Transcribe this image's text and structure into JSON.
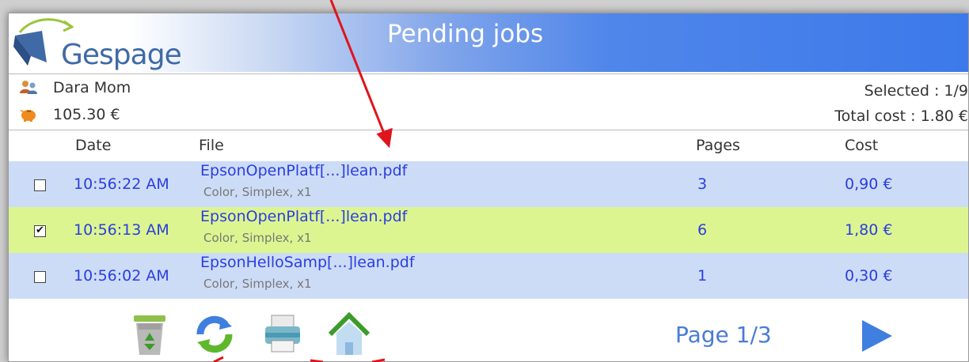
{
  "app": {
    "logo_text": "Gespage",
    "title": "Pending jobs"
  },
  "user": {
    "name": "Dara Mom",
    "balance": "105.30 €",
    "user_icon": "users-icon",
    "balance_icon": "piggy-bank-icon"
  },
  "summary": {
    "selected": "Selected : 1/9",
    "total_cost": "Total cost : 1.80 €"
  },
  "table": {
    "headers": {
      "date": "Date",
      "file": "File",
      "pages": "Pages",
      "cost": "Cost"
    },
    "rows": [
      {
        "checked": false,
        "time": "10:56:22 AM",
        "file": "EpsonOpenPlatf[...]lean.pdf",
        "options": "Color, Simplex, x1",
        "pages": "3",
        "cost": "0,90 €",
        "highlight": "blue"
      },
      {
        "checked": true,
        "time": "10:56:13 AM",
        "file": "EpsonOpenPlatf[...]lean.pdf",
        "options": "Color, Simplex, x1",
        "pages": "6",
        "cost": "1,80 €",
        "highlight": "green"
      },
      {
        "checked": false,
        "time": "10:56:02 AM",
        "file": "EpsonHelloSamp[...]lean.pdf",
        "options": "Color, Simplex, x1",
        "pages": "1",
        "cost": "0,30 €",
        "highlight": "blue"
      }
    ]
  },
  "toolbar": {
    "icons": [
      "recycle-bin-icon",
      "refresh-icon",
      "printer-icon",
      "home-icon"
    ],
    "pager": "Page 1/3",
    "next_icon": "play-next-icon"
  },
  "colors": {
    "header_blue": "#3c79ea",
    "row_blue": "#cddcf6",
    "row_green": "#ddf590",
    "link_blue": "#2a3ee0",
    "pager_blue": "#4a7bd6",
    "annotation_red": "#e0141c"
  }
}
